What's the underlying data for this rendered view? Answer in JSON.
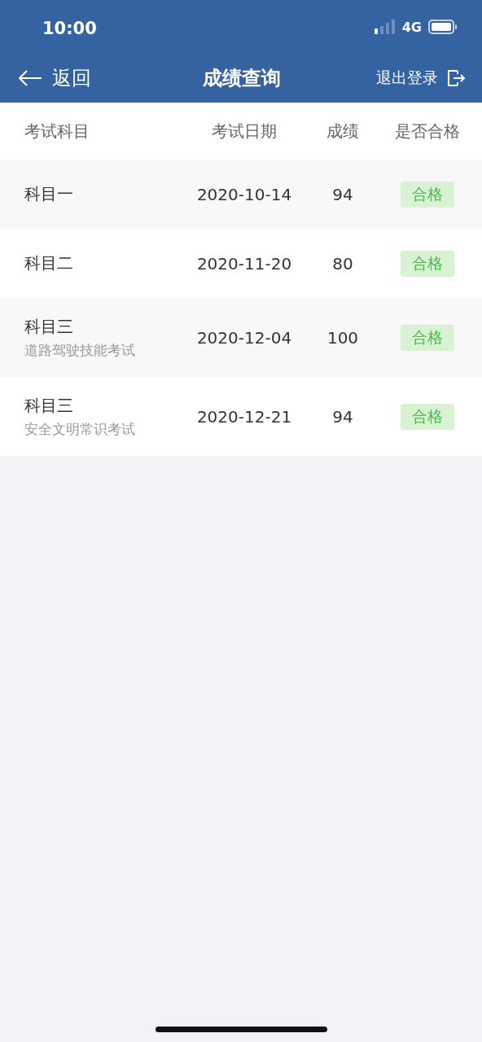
{
  "status_bar": {
    "time": "10:00",
    "network": "4G"
  },
  "nav_bar": {
    "back": "返回",
    "title": "成绩查询",
    "logout": "退出登录"
  },
  "table": {
    "columns": [
      "考试科目",
      "考试日期",
      "成绩",
      "是否合格"
    ],
    "rows": [
      {
        "subject": "科目一",
        "date": "2020-10-14",
        "score": "94",
        "result": "合格"
      },
      {
        "subject": "科目二",
        "date": "2020-11-20",
        "score": "80",
        "result": "合格"
      },
      {
        "subject": "科目三",
        "subtitle": "道路驾驶技能考试",
        "date": "2020-12-04",
        "score": "100",
        "result": "合格"
      },
      {
        "subject": "科目三",
        "subtitle": "安全文明常识考试",
        "date": "2020-12-21",
        "score": "94",
        "result": "合格"
      }
    ]
  }
}
